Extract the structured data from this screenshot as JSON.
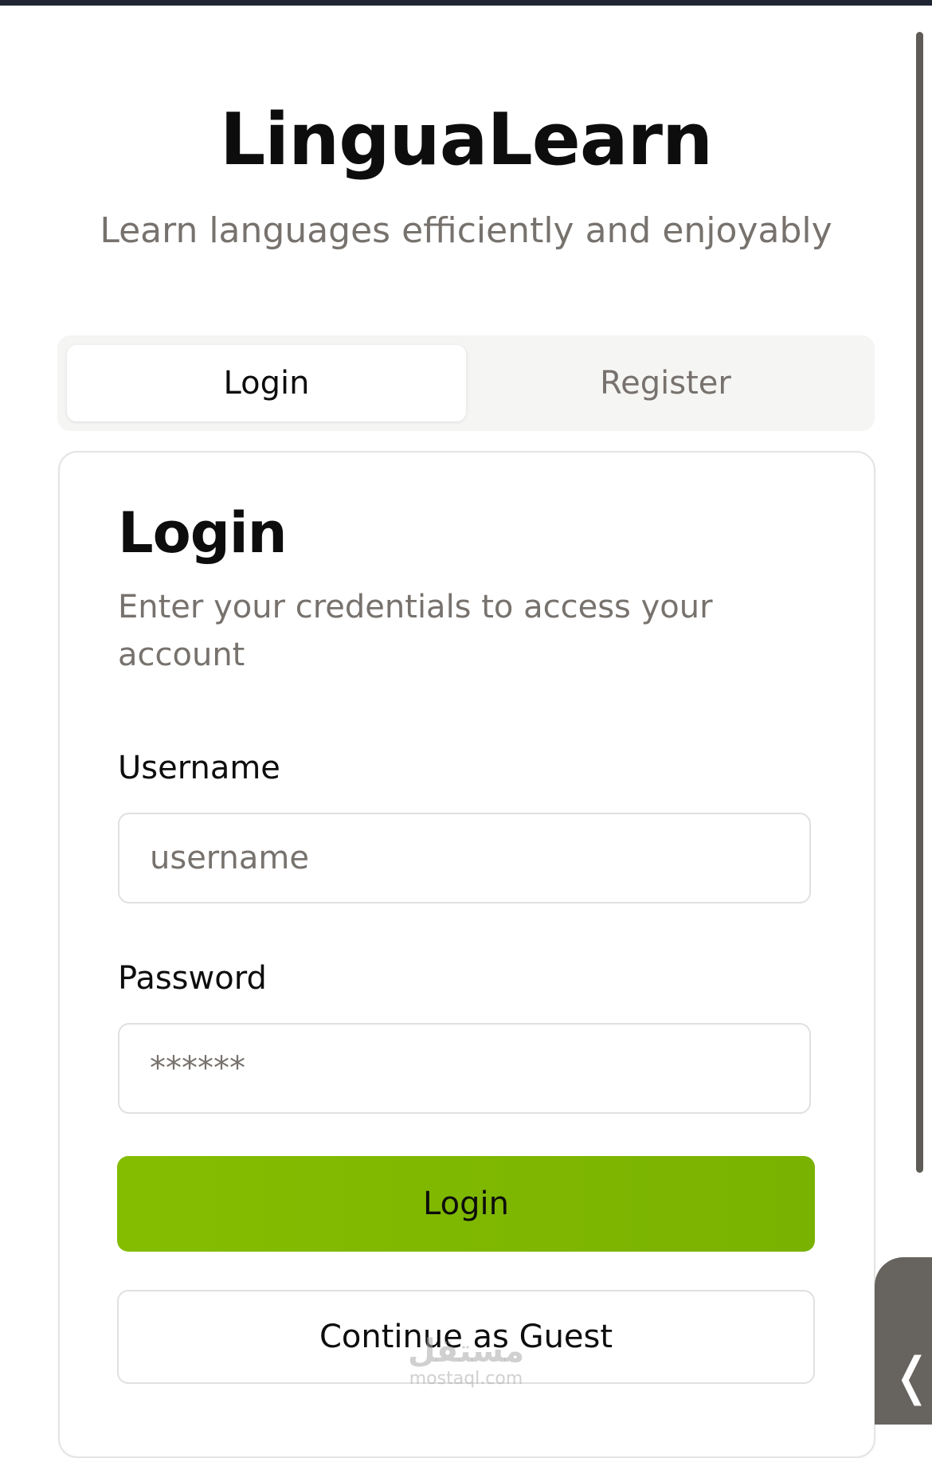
{
  "app": {
    "title": "LinguaLearn",
    "subtitle": "Learn languages efficiently and enjoyably"
  },
  "tabs": [
    {
      "label": "Login",
      "selected": true
    },
    {
      "label": "Register",
      "selected": false
    }
  ],
  "login_card": {
    "title": "Login",
    "description": "Enter your credentials to access your account",
    "username": {
      "label": "Username",
      "placeholder": "username",
      "value": ""
    },
    "password": {
      "label": "Password",
      "placeholder": "******",
      "value": ""
    },
    "submit_label": "Login",
    "guest_label": "Continue as Guest"
  },
  "watermark": {
    "mark": "مستقل",
    "text": "mostaql.com"
  },
  "side_tab": {
    "icon": "chevron-left-icon"
  },
  "colors": {
    "accent": "#84bd00",
    "text_primary": "#0d0d0d",
    "text_muted": "#77726d",
    "tab_track": "#f5f5f4",
    "border": "#e2e0de",
    "top_strip": "#1f2533",
    "side_tab": "#67645f"
  }
}
